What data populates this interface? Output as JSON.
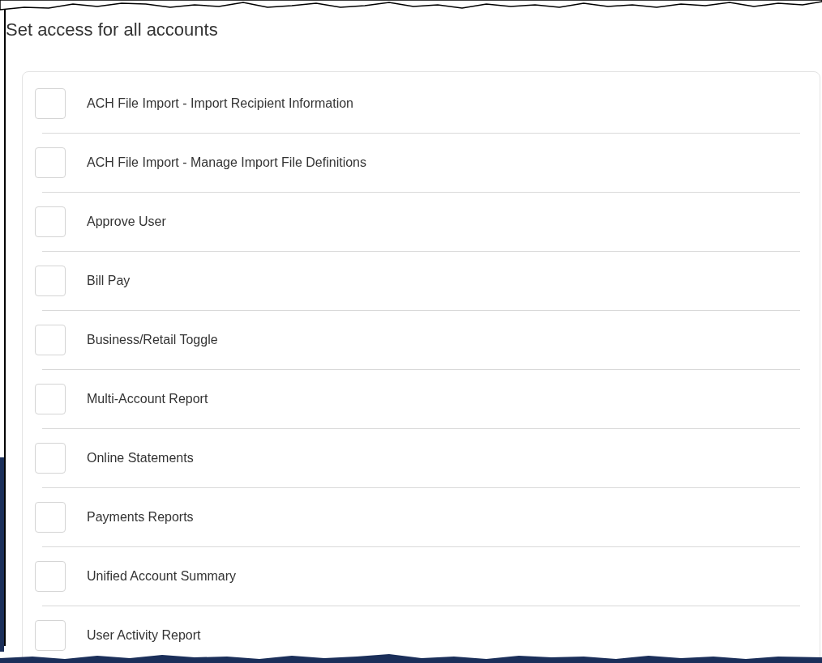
{
  "heading": "Set access for all accounts",
  "permissions": [
    {
      "label": "ACH File Import - Import Recipient Information",
      "checked": false
    },
    {
      "label": "ACH File Import - Manage Import File Definitions",
      "checked": false
    },
    {
      "label": "Approve User",
      "checked": false
    },
    {
      "label": "Bill Pay",
      "checked": false
    },
    {
      "label": "Business/Retail Toggle",
      "checked": false
    },
    {
      "label": "Multi-Account Report",
      "checked": false
    },
    {
      "label": "Online Statements",
      "checked": false
    },
    {
      "label": "Payments Reports",
      "checked": false
    },
    {
      "label": "Unified Account Summary",
      "checked": false
    },
    {
      "label": "User Activity Report",
      "checked": false
    }
  ]
}
